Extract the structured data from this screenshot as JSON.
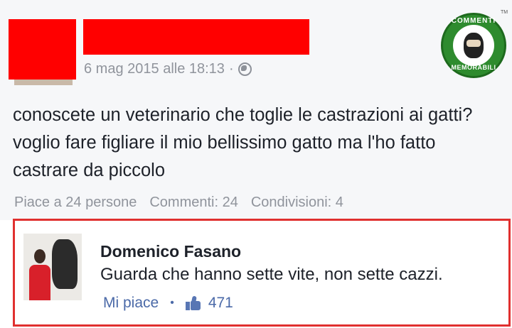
{
  "post": {
    "timestamp": "6 mag 2015 alle 18:13",
    "separator": "·",
    "text": "conoscete un veterinario che toglie le castrazioni ai gatti?voglio fare figliare il mio bellissimo gatto ma l'ho fatto castrare da piccolo",
    "stats": {
      "likes": "Piace a 24 persone",
      "comments": "Commenti: 24",
      "shares": "Condivisioni: 4"
    }
  },
  "badge": {
    "top": "COMMENTI",
    "bottom": "MEMORABILI",
    "tm": "TM"
  },
  "comment": {
    "author": "Domenico Fasano",
    "text": "Guarda che hanno sette vite, non sette cazzi.",
    "like_label": "Mi piace",
    "separator": "•",
    "like_count": "471"
  },
  "colors": {
    "redaction": "#ff0000",
    "highlight_border": "#e0302f",
    "link_blue": "#4b6aa8",
    "badge_green": "#2e8b2e"
  },
  "icons": [
    "globe-icon",
    "thumbs-up-icon"
  ]
}
